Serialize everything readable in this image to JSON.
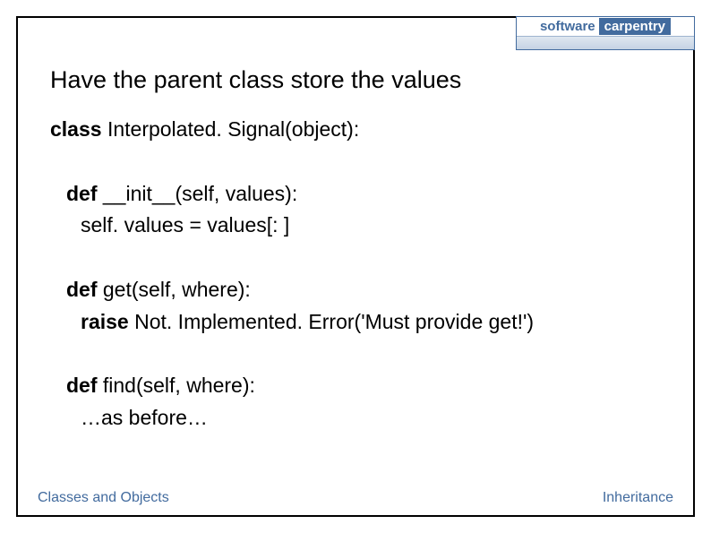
{
  "logo": {
    "left_word": "software",
    "right_word": "carpentry",
    "subtitle": ""
  },
  "heading": "Have the parent class store the values",
  "code": {
    "line1_kw": "class",
    "line1_rest": " Interpolated. Signal(object):",
    "line2_kw": "def",
    "line2_rest": " __init__(self, values):",
    "line3": "self. values = values[: ]",
    "line4_kw": "def",
    "line4_rest": " get(self, where):",
    "line5_kw": "raise",
    "line5_rest": " Not. Implemented. Error('Must provide get!')",
    "line6_kw": "def",
    "line6_rest": " find(self, where):",
    "line7": "…as before…"
  },
  "footer": {
    "left": "Classes and Objects",
    "right": "Inheritance"
  }
}
